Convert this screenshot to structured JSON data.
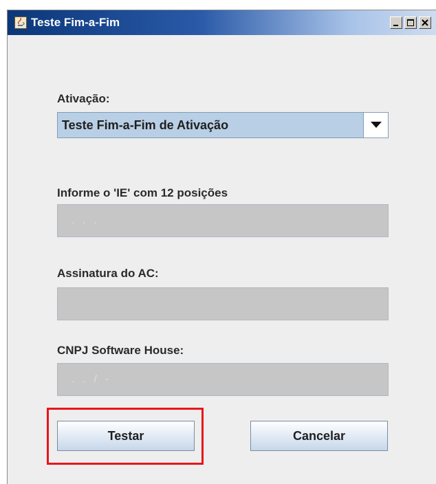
{
  "window": {
    "title": "Teste Fim-a-Fim",
    "controls": [
      "minimize",
      "maximize",
      "close"
    ]
  },
  "form": {
    "ativacao": {
      "label": "Ativação:",
      "selected": "Teste Fim-a-Fim de Ativação"
    },
    "ie": {
      "label": "Informe o 'IE' com 12 posições",
      "mask": ". . ."
    },
    "assinatura": {
      "label": "Assinatura do AC:",
      "value": ""
    },
    "cnpj": {
      "label": "CNPJ Software House:",
      "mask": ". . /  -"
    }
  },
  "buttons": {
    "testar": "Testar",
    "cancelar": "Cancelar"
  },
  "colors": {
    "highlight": "#e8151a",
    "field_disabled": "#c6c6c6",
    "combo_selected": "#b8cfe5"
  },
  "icons": {
    "app": "java-cup-icon",
    "dropdown": "triangle-down-icon"
  }
}
